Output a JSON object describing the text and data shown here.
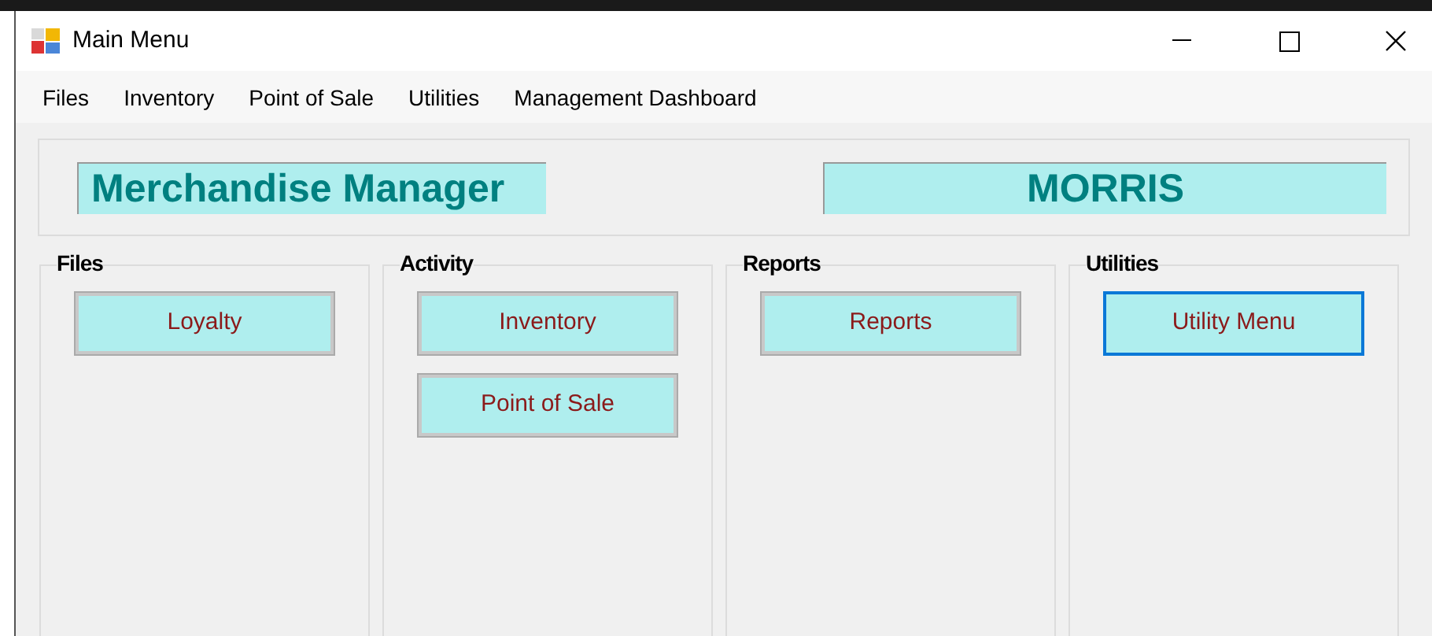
{
  "window": {
    "title": "Main Menu"
  },
  "menu": [
    "Files",
    "Inventory",
    "Point of Sale",
    "Utilities",
    "Management Dashboard"
  ],
  "header": {
    "app_name": "Merchandise Manager",
    "user": "MORRIS"
  },
  "groups": [
    {
      "title": "Files",
      "buttons": [
        {
          "label": "Loyalty",
          "focused": false
        }
      ]
    },
    {
      "title": "Activity",
      "buttons": [
        {
          "label": "Inventory",
          "focused": false
        },
        {
          "label": "Point of Sale",
          "focused": false
        }
      ]
    },
    {
      "title": "Reports",
      "buttons": [
        {
          "label": "Reports",
          "focused": false
        }
      ]
    },
    {
      "title": "Utilities",
      "buttons": [
        {
          "label": "Utility Menu",
          "focused": true
        }
      ]
    }
  ]
}
